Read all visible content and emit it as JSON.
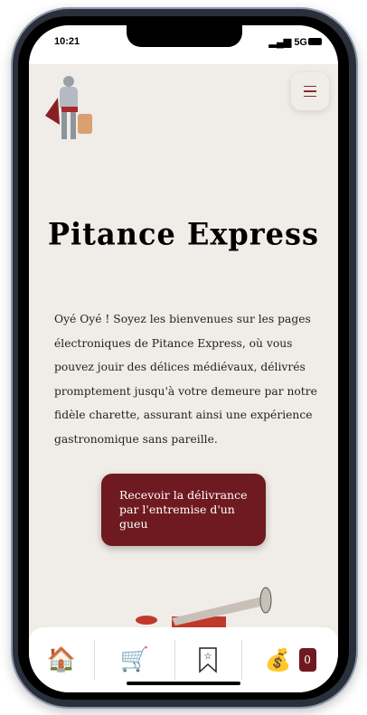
{
  "status": {
    "time": "10:21",
    "network": "5G"
  },
  "header": {
    "menu_icon": "hamburger-icon",
    "logo": "knight-logo"
  },
  "title": "Pitance Express",
  "intro": "Oyé Oyé ! Soyez les bienvenues sur les pages électroniques de Pitance Express, où vous pouvez jouir des délices médiévaux, délivrés promptement jusqu'à votre demeure par notre fidèle charette, assurant ainsi une expérience gastronomique sans pareille.",
  "cta": "Recevoir la délivrance par l'entremise d'un gueu",
  "nav": {
    "items": [
      "home-icon",
      "wagon-icon",
      "bookmark-star-icon",
      "money-bag-icon"
    ],
    "cart_count": "0"
  },
  "colors": {
    "accent": "#6e1a20",
    "background": "#f0ece7"
  }
}
